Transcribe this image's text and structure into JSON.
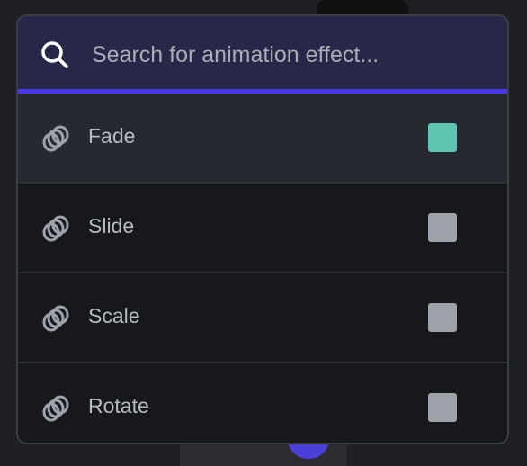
{
  "search": {
    "placeholder": "Search for animation effect...",
    "icon": "search-icon"
  },
  "effects": [
    {
      "label": "Fade",
      "icon": "rings-icon",
      "checked": true,
      "highlighted": true
    },
    {
      "label": "Slide",
      "icon": "rings-icon",
      "checked": false,
      "highlighted": false
    },
    {
      "label": "Scale",
      "icon": "rings-icon",
      "checked": false,
      "highlighted": false
    },
    {
      "label": "Rotate",
      "icon": "rings-icon",
      "checked": false,
      "highlighted": false
    }
  ],
  "colors": {
    "accent": "#4a38e8",
    "checked": "#5fc4b2",
    "unchecked": "#9ea3ab",
    "search_background": "#272848"
  }
}
